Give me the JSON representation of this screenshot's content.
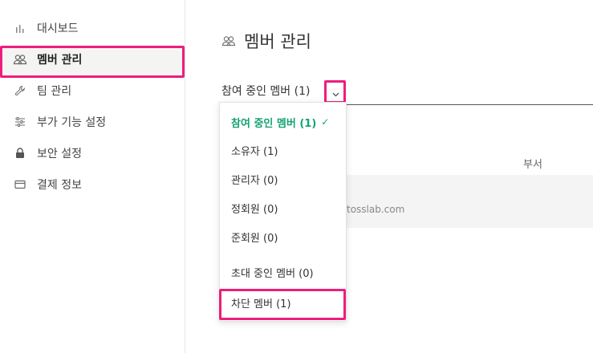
{
  "sidebar": {
    "items": [
      {
        "label": "대시보드",
        "icon": "bar-chart-icon"
      },
      {
        "label": "멤버 관리",
        "icon": "members-icon",
        "active": true
      },
      {
        "label": "팀 관리",
        "icon": "wrench-icon"
      },
      {
        "label": "부가 기능 설정",
        "icon": "sliders-icon"
      },
      {
        "label": "보안 설정",
        "icon": "lock-icon"
      },
      {
        "label": "결제 정보",
        "icon": "card-icon"
      }
    ]
  },
  "main": {
    "title": "멤버 관리",
    "filter_label": "참여 중인 멤버 (1)",
    "column_header": "부서",
    "row_email_partial": "tosslab.com"
  },
  "dropdown": {
    "items": [
      {
        "label": "참여 중인 멤버 (1)",
        "selected": true
      },
      {
        "label": "소유자 (1)"
      },
      {
        "label": "관리자 (0)"
      },
      {
        "label": "정회원 (0)"
      },
      {
        "label": "준회원 (0)"
      },
      {
        "label": "초대 중인 멤버 (0)"
      },
      {
        "label": "차단 멤버 (1)"
      }
    ],
    "check_glyph": "✓"
  },
  "colors": {
    "accent_green": "#16a274",
    "highlight_pink": "#ec1e7d"
  }
}
